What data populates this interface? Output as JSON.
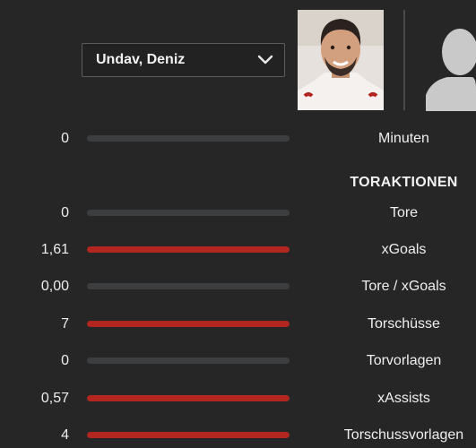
{
  "player_select": {
    "selected": "Undav, Deniz",
    "icon": "chevron-down-icon"
  },
  "section_title": "TORAKTIONEN",
  "colors": {
    "fill": "#b3251f",
    "track": "#3c3e3f",
    "background": "#262626"
  },
  "stats": [
    {
      "label": "Minuten",
      "value": "0",
      "fill": 0
    },
    {
      "label": "Tore",
      "value": "0",
      "fill": 0
    },
    {
      "label": "xGoals",
      "value": "1,61",
      "fill": 1
    },
    {
      "label": "Tore / xGoals",
      "value": "0,00",
      "fill": 0
    },
    {
      "label": "Torschüsse",
      "value": "7",
      "fill": 1
    },
    {
      "label": "Torvorlagen",
      "value": "0",
      "fill": 0
    },
    {
      "label": "xAssists",
      "value": "0,57",
      "fill": 1
    },
    {
      "label": "Torschussvorlagen",
      "value": "4",
      "fill": 1
    }
  ]
}
